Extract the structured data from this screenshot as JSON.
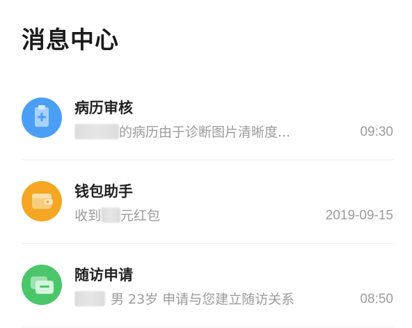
{
  "header": {
    "title": "消息中心"
  },
  "messages": [
    {
      "title": "病历审核",
      "preview_before": "",
      "preview_after": "的病历由于诊断图片清晰度...",
      "time": "09:30",
      "icon": "medical-record-icon",
      "color": "#4a9ff5"
    },
    {
      "title": "钱包助手",
      "preview_before": "收到",
      "preview_after": "元红包",
      "time": "2019-09-15",
      "icon": "wallet-icon",
      "color": "#f5a623"
    },
    {
      "title": "随访申请",
      "preview_before": "",
      "preview_after": "男 23岁 申请与您建立随访关系",
      "time": "08:50",
      "icon": "chat-bubble-icon",
      "color": "#4cc66a"
    }
  ]
}
